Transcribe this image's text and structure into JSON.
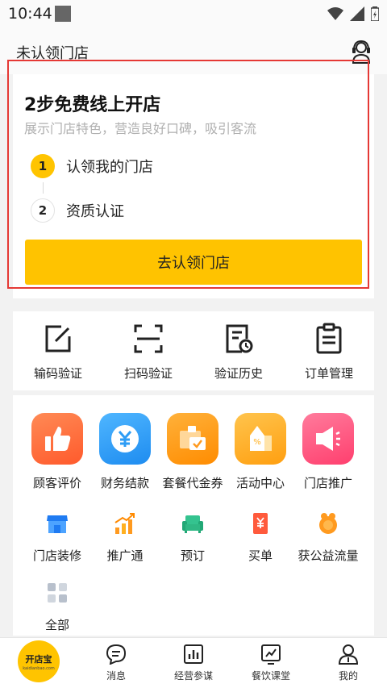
{
  "status": {
    "time": "10:44"
  },
  "header": {
    "title": "未认领门店"
  },
  "claim": {
    "title": "2步免费线上开店",
    "subtitle": "展示门店特色，营造良好口碑，吸引客流",
    "steps": [
      {
        "number": "1",
        "label": "认领我的门店"
      },
      {
        "number": "2",
        "label": "资质认证"
      }
    ],
    "button_label": "去认领门店"
  },
  "tools": [
    {
      "label": "输码验证",
      "icon": "edit-icon"
    },
    {
      "label": "扫码验证",
      "icon": "scan-icon"
    },
    {
      "label": "验证历史",
      "icon": "history-icon"
    },
    {
      "label": "订单管理",
      "icon": "clipboard-icon"
    }
  ],
  "services": [
    {
      "label": "顾客评价",
      "icon": "thumbs-up-icon",
      "color": "#ff6f3c"
    },
    {
      "label": "财务结款",
      "icon": "yen-coin-icon",
      "color": "#2d9cf5"
    },
    {
      "label": "套餐代金券",
      "icon": "voucher-icon",
      "color": "#ff9a1f"
    },
    {
      "label": "活动中心",
      "icon": "activity-icon",
      "color": "#ffb020"
    },
    {
      "label": "门店推广",
      "icon": "megaphone-icon",
      "color": "#ff4f7b"
    }
  ],
  "more_services": [
    {
      "label": "门店装修",
      "icon": "store-icon"
    },
    {
      "label": "推广通",
      "icon": "chart-up-icon"
    },
    {
      "label": "预订",
      "icon": "sofa-icon"
    },
    {
      "label": "买单",
      "icon": "bill-icon"
    },
    {
      "label": "获公益流量",
      "icon": "charity-icon"
    }
  ],
  "all_label": "全部",
  "bottom_nav": {
    "logo_text": "开店宝",
    "logo_sub": "kaidianbao.com",
    "items": [
      {
        "label": "消息",
        "icon": "message-icon"
      },
      {
        "label": "经营参谋",
        "icon": "analytics-icon"
      },
      {
        "label": "餐饮课堂",
        "icon": "classroom-icon"
      },
      {
        "label": "我的",
        "icon": "profile-icon"
      }
    ]
  },
  "colors": {
    "accent": "#ffc300",
    "highlight": "#e53935"
  }
}
